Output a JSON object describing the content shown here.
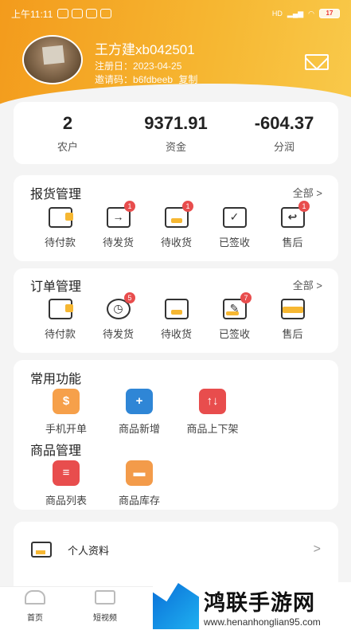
{
  "status": {
    "time": "上午11:11",
    "battery": "17"
  },
  "user": {
    "name": "王方建xb042501",
    "register_label": "注册日：",
    "register_date": "2023-04-25",
    "invite_label": "邀请码：",
    "invite_code": "b6fdbeeb",
    "copy_label": "复制"
  },
  "stats": [
    {
      "value": "2",
      "label": "农户"
    },
    {
      "value": "9371.91",
      "label": "资金"
    },
    {
      "value": "-604.37",
      "label": "分润"
    }
  ],
  "report": {
    "title": "报货管理",
    "more": "全部 >",
    "items": [
      {
        "label": "待付款",
        "badge": "",
        "glyph": ""
      },
      {
        "label": "待发货",
        "badge": "1",
        "glyph": "→"
      },
      {
        "label": "待收货",
        "badge": "1",
        "glyph": ""
      },
      {
        "label": "已签收",
        "badge": "",
        "glyph": "✓"
      },
      {
        "label": "售后",
        "badge": "1",
        "glyph": "↩"
      }
    ]
  },
  "orders": {
    "title": "订单管理",
    "more": "全部 >",
    "items": [
      {
        "label": "待付款",
        "badge": "",
        "glyph": ""
      },
      {
        "label": "待发货",
        "badge": "5",
        "glyph": "◷"
      },
      {
        "label": "待收货",
        "badge": "",
        "glyph": ""
      },
      {
        "label": "已签收",
        "badge": "7",
        "glyph": "✎"
      },
      {
        "label": "售后",
        "badge": "",
        "glyph": ""
      }
    ]
  },
  "functions": {
    "title": "常用功能",
    "items": [
      {
        "label": "手机开单",
        "icon": "phone-order-icon",
        "color": "#f6a04a",
        "glyph": "$"
      },
      {
        "label": "商品新增",
        "icon": "product-add-icon",
        "color": "#2f86d6",
        "glyph": "+"
      },
      {
        "label": "商品上下架",
        "icon": "product-shelf-icon",
        "color": "#e84d4d",
        "glyph": "↑↓"
      }
    ]
  },
  "goods": {
    "title": "商品管理",
    "items": [
      {
        "label": "商品列表",
        "icon": "product-list-icon",
        "color": "#e84d4d",
        "glyph": "≡"
      },
      {
        "label": "商品库存",
        "icon": "product-stock-icon",
        "color": "#f39b4a",
        "glyph": "▬"
      }
    ]
  },
  "profile": {
    "label": "个人资料",
    "arrow": ">"
  },
  "tabs": [
    {
      "label": "首页"
    },
    {
      "label": "短视频"
    }
  ],
  "watermark": {
    "name": "鸿联手游网",
    "url": "www.henanhonglian95.com"
  }
}
